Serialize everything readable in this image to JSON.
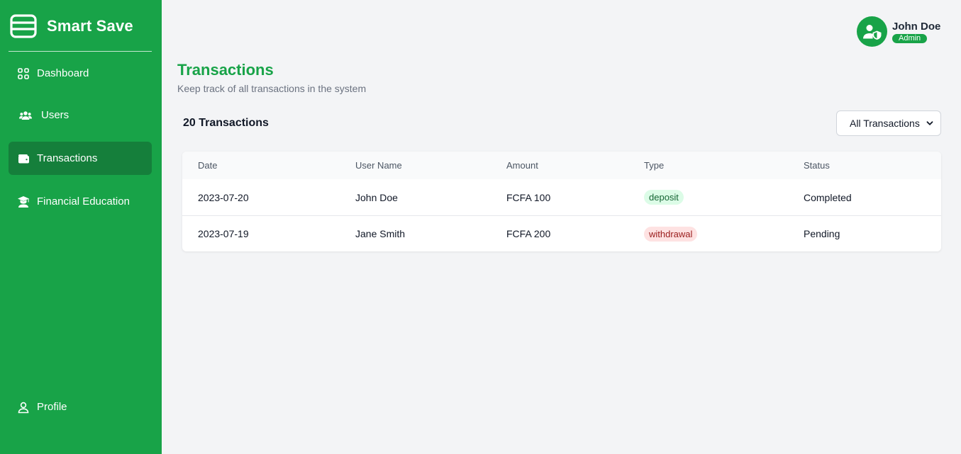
{
  "brand": {
    "name": "Smart Save"
  },
  "sidebar": {
    "items": [
      {
        "label": "Dashboard",
        "icon": "grid-icon"
      },
      {
        "label": "Users",
        "icon": "users-icon"
      },
      {
        "label": "Transactions",
        "icon": "wallet-icon",
        "active": true
      },
      {
        "label": "Financial Education",
        "icon": "graduation-icon"
      }
    ],
    "profile": {
      "label": "Profile",
      "icon": "user-icon"
    }
  },
  "user": {
    "name": "John Doe",
    "role": "Admin"
  },
  "page": {
    "title": "Transactions",
    "subtitle": "Keep track of all transactions in the system",
    "count_label": "20 Transactions"
  },
  "filter": {
    "selected": "All Transactions"
  },
  "table": {
    "columns": [
      "Date",
      "User Name",
      "Amount",
      "Type",
      "Status"
    ],
    "rows": [
      {
        "date": "2023-07-20",
        "user": "John Doe",
        "amount": "FCFA 100",
        "type": "deposit",
        "status": "Completed"
      },
      {
        "date": "2023-07-19",
        "user": "Jane Smith",
        "amount": "FCFA 200",
        "type": "withdrawal",
        "status": "Pending"
      }
    ]
  },
  "colors": {
    "brand_green": "#18a348",
    "active_nav": "#157f3b",
    "deposit_bg": "#dcfce7",
    "withdrawal_bg": "#fee2e2"
  }
}
